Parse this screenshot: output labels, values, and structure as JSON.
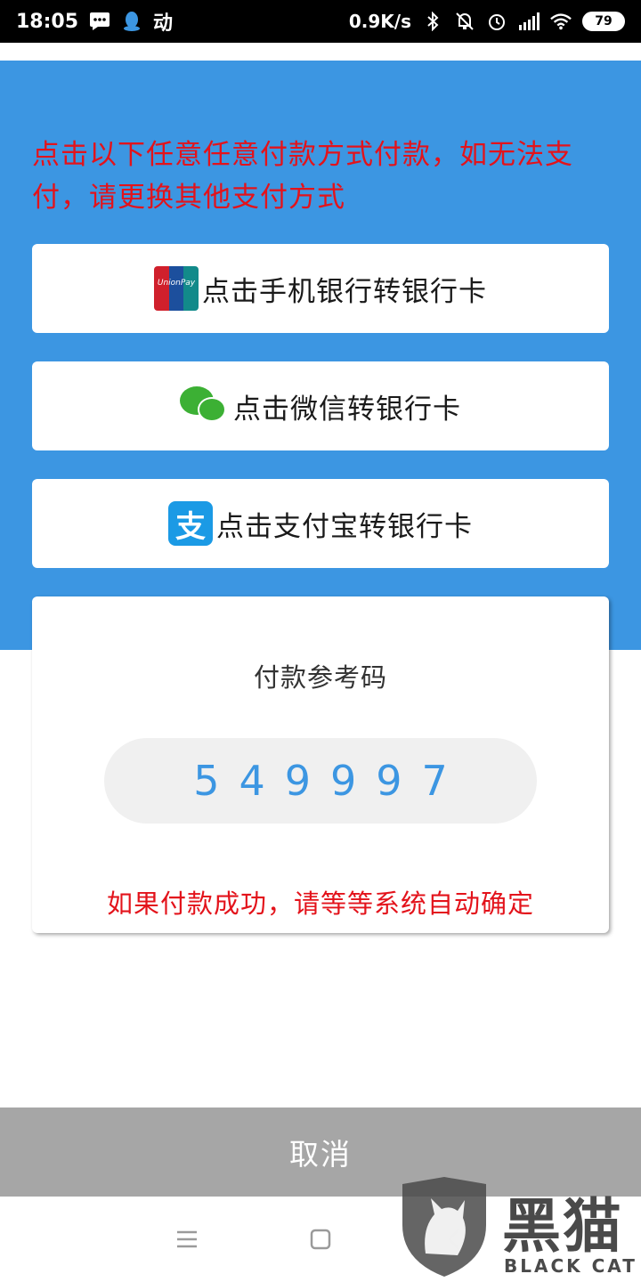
{
  "status_bar": {
    "time": "18:05",
    "app_glyph": "动",
    "net_speed": "0.9K/s",
    "battery": "79",
    "icons": [
      "message-icon",
      "qq-penguin-icon",
      "bluetooth-icon",
      "mute-icon",
      "alarm-icon",
      "signal-icon",
      "wifi-icon",
      "battery-icon"
    ]
  },
  "header": {
    "notice": "点击以下任意任意付款方式付款，如无法支付，请更换其他支付方式"
  },
  "payment_options": [
    {
      "label": "点击手机银行转银行卡",
      "icon": "unionpay-icon"
    },
    {
      "label": "点击微信转银行卡",
      "icon": "wechat-icon"
    },
    {
      "label": "点击支付宝转银行卡",
      "icon": "alipay-icon",
      "icon_glyph": "支"
    }
  ],
  "reference": {
    "title": "付款参考码",
    "code": "549997",
    "hint": "如果付款成功，请等等系统自动确定"
  },
  "cancel_label": "取消",
  "watermark": {
    "brand_cn": "黑猫",
    "brand_en": "BLACK CAT"
  },
  "colors": {
    "header_blue": "#3c96e2",
    "alert_red": "#e3131b",
    "code_blue": "#3c96e2",
    "cancel_gray": "#a6a6a6"
  }
}
